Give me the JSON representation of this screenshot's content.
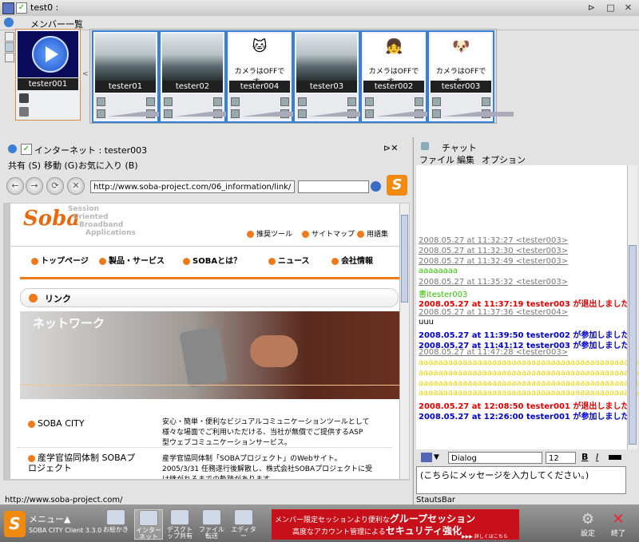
{
  "window": {
    "title": "test0 :",
    "buttons": [
      "⊳",
      "□",
      "✕"
    ]
  },
  "members": {
    "header": "メンバー一覧",
    "self": {
      "name": "tester001"
    },
    "cards": [
      {
        "name": "tester01",
        "video": "office",
        "camera_text": ""
      },
      {
        "name": "tester02",
        "video": "office",
        "camera_text": ""
      },
      {
        "name": "tester004",
        "video": "cat",
        "camera_text": "カメラはOFFです。"
      },
      {
        "name": "tester03",
        "video": "office",
        "camera_text": ""
      },
      {
        "name": "tester002",
        "video": "face",
        "camera_text": "カメラはOFFです。"
      },
      {
        "name": "tester003",
        "video": "dog",
        "camera_text": "カメラはOFFです。"
      }
    ]
  },
  "browser": {
    "title": "インターネット : tester003",
    "menu": [
      "共有 (S)",
      "移動 (G)",
      "お気に入り (B)"
    ],
    "url": "http://www.soba-project.com/06_information/link/",
    "search_value": "",
    "status_url": "http://www.soba-project.com/",
    "site": {
      "logo": "Soba",
      "tagline": [
        "Session",
        "Oriented",
        "Broadband",
        "Applications"
      ],
      "top_links": [
        "推奨ツール",
        "サイトマップ",
        "用語集"
      ],
      "nav": [
        "トップページ",
        "製品・サービス",
        "SOBAとは？",
        "ニュース",
        "会社情報"
      ],
      "section": "リンク",
      "banner": "ネットワーク",
      "links": [
        {
          "name": "SOBA CITY",
          "desc": "安心・簡単・便利なビジュアルコミュニケーションツールとして様々な場面でご利用いただける、当社が無償でご提供するASP型ウェブコミュニケーションサービス。"
        },
        {
          "name": "産学官協同体制 SOBAプロジェクト",
          "desc": "産学官協同体制「SOBAプロジェクト」のWebサイト。2005/3/31 任務遂行後解散し、株式会社SOBAプロジェクトに受け継がれるまでの軌跡があります。"
        }
      ]
    }
  },
  "chat": {
    "title": "チャット",
    "menu": [
      "ファイル",
      "編集",
      "オプション"
    ],
    "lines": [
      {
        "text": "2008.05.27 at 11:32:27 <tester003>",
        "style": "ts"
      },
      {
        "text": "2008.05.27 at 11:32:30 <tester003>",
        "style": "ts"
      },
      {
        "text": "2008.05.27 at 11:32:49 <tester003>",
        "style": "ts"
      },
      {
        "text": "aaaaaaaa",
        "style": "grn"
      },
      {
        "text": "2008.05.27 at 11:35:32 <tester003>",
        "style": "ts"
      },
      {
        "text": "書itester003",
        "style": "grn"
      },
      {
        "text": "2008.05.27 at 11:37:19 tester003 が退出しました。",
        "style": "red"
      },
      {
        "text": "2008.05.27 at 11:37:36 <tester004>",
        "style": "ts"
      },
      {
        "text": "uuu",
        "style": "plain"
      },
      {
        "text": "2008.05.27 at 11:39:50 tester002 が参加しました。",
        "style": "blue"
      },
      {
        "text": "2008.05.27 at 11:41:12 tester003 が参加しました。",
        "style": "blue"
      },
      {
        "text": "2008.05.27 at 11:47:28 <tester003>",
        "style": "ts"
      },
      {
        "text": "aaaaaaaaaaaaaaaaaaaaaaaaaaaaaaaaaaaaaaaaaaaaaaaaa",
        "style": "yel"
      },
      {
        "text": "aaaaaaaaaaaaaaaaaaaaaaaaaaaaaaaaaaaaaaaaaaaaaaaaa",
        "style": "yel"
      },
      {
        "text": "aaaaaaaaaaaaaaaaaaaaaaaaaaaaaaaaaaaaaaaaaaaaaaaaa",
        "style": "yel"
      },
      {
        "text": "aaaaaaaaaaaaaaaaaaaaaaaaaaaaaaaaaaaaaaaaaaaaaaaaa",
        "style": "yel"
      },
      {
        "text": "2008.05.27 at 12:08:50 tester001 が退出しました。",
        "style": "red"
      },
      {
        "text": "2008.05.27 at 12:26:00 tester001 が参加しました。",
        "style": "blue"
      }
    ],
    "font": "Dialog",
    "size": "12",
    "input_text": "(こちらにメッセージを入力してください。)",
    "status": "StautsBar"
  },
  "taskbar": {
    "menu_label": "メニュー▲",
    "client": "SOBA CITY Client 3.3.0",
    "apps": [
      "お絵かき",
      "インターネット",
      "デスクトップ共有",
      "ファイル転送",
      "エディター"
    ],
    "banner": {
      "line1a": "メンバー限定セッションより便利な",
      "line1b": "グループセッション",
      "line2a": "高度なアカウント管理による",
      "line2b": "セキュリティ強化",
      "more": "▶▶▶ 詳しくはこちら"
    },
    "settings": "設定",
    "exit": "終了"
  }
}
